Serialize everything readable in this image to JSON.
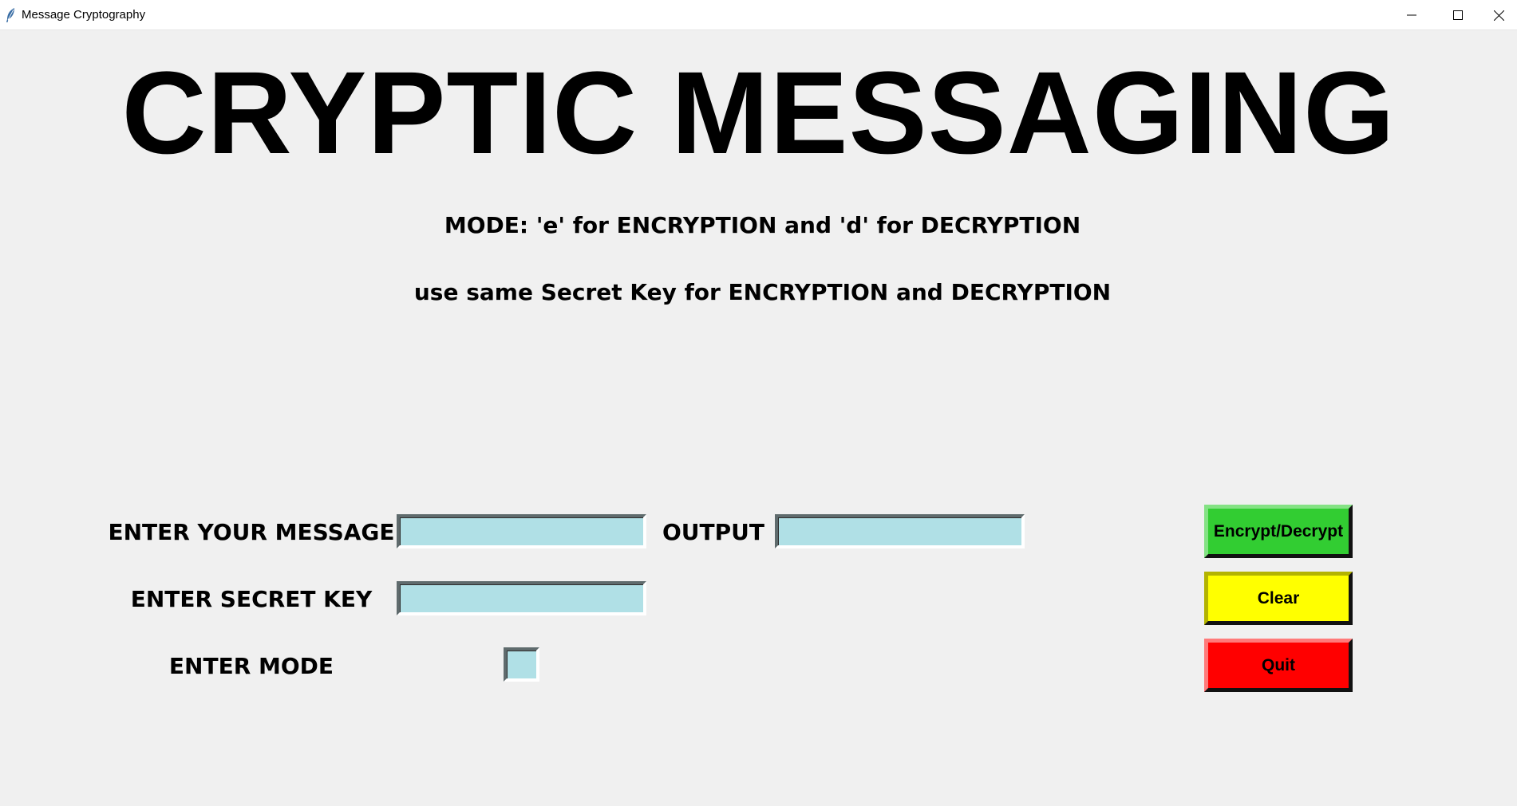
{
  "window": {
    "title": "Message Cryptography",
    "icon": "feather-icon",
    "controls": [
      "minimize-icon",
      "maximize-icon",
      "close-icon"
    ]
  },
  "header": {
    "title": "CRYPTIC MESSAGING",
    "mode_info": "MODE: 'e' for ENCRYPTION and 'd' for DECRYPTION",
    "key_info": "use same Secret Key for ENCRYPTION and DECRYPTION"
  },
  "form": {
    "message_label": "ENTER YOUR MESSAGE",
    "message_value": "",
    "output_label": "OUTPUT",
    "output_value": "",
    "key_label": "ENTER SECRET KEY",
    "key_value": "",
    "mode_label": "ENTER MODE",
    "mode_value": ""
  },
  "buttons": {
    "encrypt_label": "Encrypt/Decrypt",
    "clear_label": "Clear",
    "quit_label": "Quit"
  },
  "colors": {
    "background": "#f0f0f0",
    "entry_bg": "#b0e0e6",
    "encrypt_bg": "#32cd32",
    "clear_bg": "#ffff00",
    "quit_bg": "#ff0000"
  }
}
